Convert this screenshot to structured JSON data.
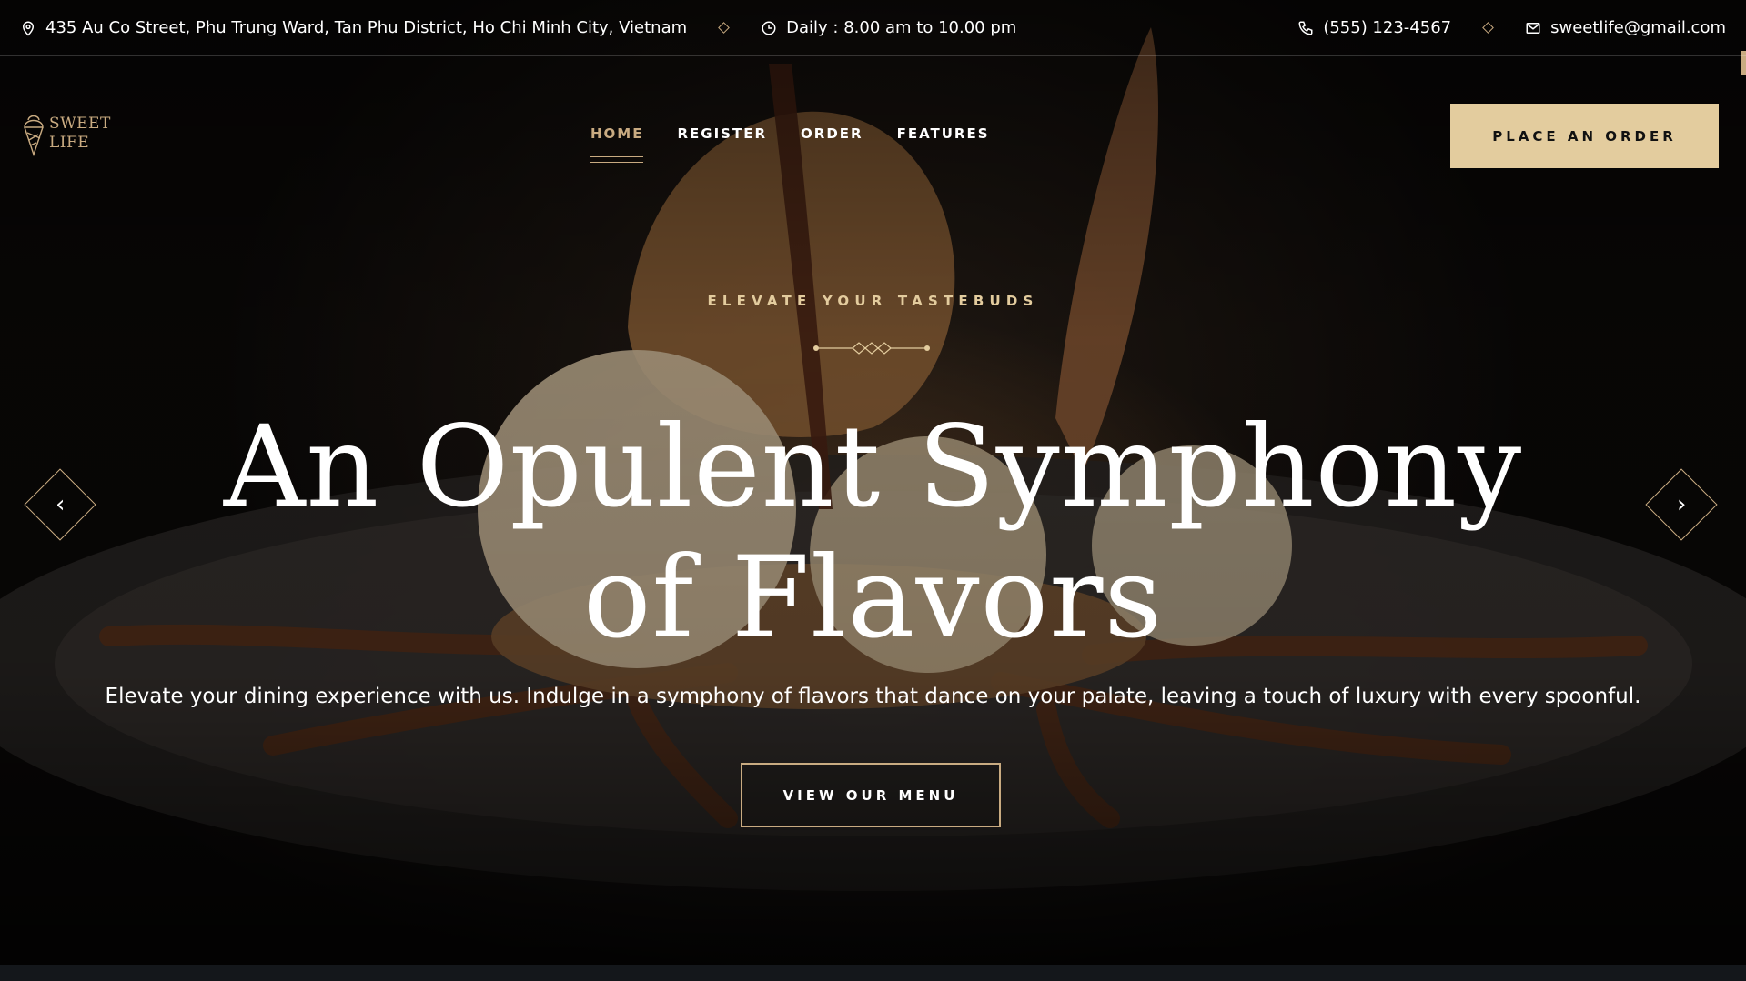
{
  "topbar": {
    "address": "435 Au Co Street, Phu Trung Ward, Tan Phu District, Ho Chi Minh City, Vietnam",
    "hours": "Daily : 8.00 am to 10.00 pm",
    "phone": "(555) 123-4567",
    "email": "sweetlife@gmail.com",
    "icons": [
      "map-pin-icon",
      "clock-icon",
      "phone-icon",
      "mail-icon"
    ]
  },
  "brand": {
    "name_line1": "SWEET",
    "name_line2": "LIFE",
    "logo_icon": "ice-cream-cone-icon"
  },
  "nav": {
    "items": [
      {
        "label": "HOME",
        "active": true
      },
      {
        "label": "REGISTER",
        "active": false
      },
      {
        "label": "ORDER",
        "active": false
      },
      {
        "label": "FEATURES",
        "active": false
      }
    ]
  },
  "header": {
    "order_button": "PLACE AN ORDER"
  },
  "hero": {
    "eyebrow": "ELEVATE YOUR TASTEBUDS",
    "headline_line1": "An Opulent Symphony",
    "headline_line2": "of Flavors",
    "subtext": "Elevate your dining experience with us. Indulge in a symphony of flavors that dance on your palate, leaving a touch of luxury with every spoonful.",
    "cta": "VIEW OUR MENU",
    "prev_icon": "chevron-left-icon",
    "next_icon": "chevron-right-icon"
  },
  "colors": {
    "accent": "#c9ab81",
    "button_fill": "#e3cc9e",
    "background": "#0e1013",
    "text": "#ffffff"
  }
}
